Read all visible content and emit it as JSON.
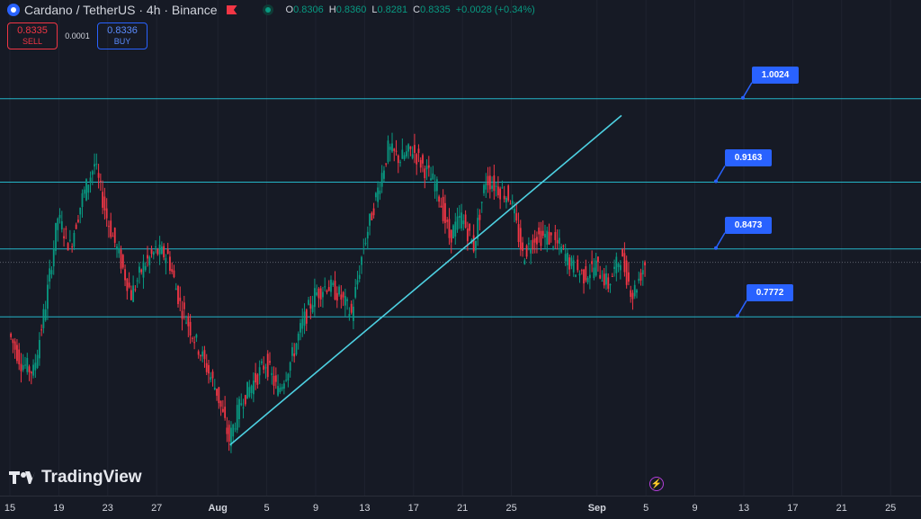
{
  "header": {
    "title": "Cardano / TetherUS · 4h · Binance",
    "ohlc": [
      {
        "k": "O",
        "v": "0.8306"
      },
      {
        "k": "H",
        "v": "0.8360"
      },
      {
        "k": "L",
        "v": "0.8281"
      },
      {
        "k": "C",
        "v": "0.8335"
      },
      {
        "k": "",
        "v": "+0.0028 (+0.34%)"
      }
    ]
  },
  "trade": {
    "sell_price": "0.8335",
    "sell_label": "SELL",
    "spread": "0.0001",
    "buy_price": "0.8336",
    "buy_label": "BUY"
  },
  "branding": {
    "logo_text": "TradingView",
    "flash_icon": "lightning-icon"
  },
  "colors": {
    "up": "#089981",
    "down": "#f23645",
    "level_line": "#26c6da",
    "label_bg": "#2962ff",
    "background": "#161a25"
  },
  "chart_data": {
    "type": "candlestick",
    "symbol": "ADA/USDT",
    "interval": "4h",
    "exchange": "Binance",
    "x_ticks": [
      "15",
      "19",
      "23",
      "27",
      "Aug",
      "5",
      "9",
      "13",
      "17",
      "21",
      "25",
      "Sep",
      "5",
      "9",
      "13",
      "17",
      "21",
      "25"
    ],
    "x_ticks_bold": [
      "Aug",
      "Sep"
    ],
    "ylim": [
      0.5925,
      1.1044
    ],
    "last_price": 0.8335,
    "horizontal_levels": [
      {
        "value": 1.0024,
        "label": "1.0024"
      },
      {
        "value": 0.9163,
        "label": "0.9163"
      },
      {
        "value": 0.8473,
        "label": "0.8473"
      },
      {
        "value": 0.7772,
        "label": "0.7772"
      }
    ],
    "trendline": {
      "from": {
        "date": "Aug 2",
        "value": 0.6449
      },
      "to": {
        "date": "Sep 3",
        "value": 0.9851
      }
    },
    "approx_close_path": [
      {
        "date": "Jul 15",
        "value": 0.76
      },
      {
        "date": "Jul 16",
        "value": 0.73
      },
      {
        "date": "Jul 17",
        "value": 0.72
      },
      {
        "date": "Jul 18",
        "value": 0.79
      },
      {
        "date": "Jul 19",
        "value": 0.88
      },
      {
        "date": "Jul 20",
        "value": 0.85
      },
      {
        "date": "Jul 21",
        "value": 0.9
      },
      {
        "date": "Jul 22",
        "value": 0.935
      },
      {
        "date": "Jul 23",
        "value": 0.88
      },
      {
        "date": "Jul 24",
        "value": 0.84
      },
      {
        "date": "Jul 25",
        "value": 0.8
      },
      {
        "date": "Jul 26",
        "value": 0.83
      },
      {
        "date": "Jul 27",
        "value": 0.845
      },
      {
        "date": "Jul 28",
        "value": 0.84
      },
      {
        "date": "Jul 29",
        "value": 0.79
      },
      {
        "date": "Jul 30",
        "value": 0.76
      },
      {
        "date": "Jul 31",
        "value": 0.73
      },
      {
        "date": "Aug 1",
        "value": 0.7
      },
      {
        "date": "Aug 2",
        "value": 0.65
      },
      {
        "date": "Aug 3",
        "value": 0.69
      },
      {
        "date": "Aug 4",
        "value": 0.71
      },
      {
        "date": "Aug 5",
        "value": 0.73
      },
      {
        "date": "Aug 6",
        "value": 0.7
      },
      {
        "date": "Aug 7",
        "value": 0.73
      },
      {
        "date": "Aug 8",
        "value": 0.77
      },
      {
        "date": "Aug 9",
        "value": 0.8
      },
      {
        "date": "Aug 10",
        "value": 0.81
      },
      {
        "date": "Aug 11",
        "value": 0.8
      },
      {
        "date": "Aug 12",
        "value": 0.78
      },
      {
        "date": "Aug 13",
        "value": 0.85
      },
      {
        "date": "Aug 14",
        "value": 0.9
      },
      {
        "date": "Aug 15",
        "value": 0.95
      },
      {
        "date": "Aug 16",
        "value": 0.94
      },
      {
        "date": "Aug 17",
        "value": 0.95
      },
      {
        "date": "Aug 18",
        "value": 0.93
      },
      {
        "date": "Aug 19",
        "value": 0.91
      },
      {
        "date": "Aug 20",
        "value": 0.86
      },
      {
        "date": "Aug 21",
        "value": 0.88
      },
      {
        "date": "Aug 22",
        "value": 0.85
      },
      {
        "date": "Aug 23",
        "value": 0.92
      },
      {
        "date": "Aug 24",
        "value": 0.91
      },
      {
        "date": "Aug 25",
        "value": 0.9
      },
      {
        "date": "Aug 26",
        "value": 0.84
      },
      {
        "date": "Aug 27",
        "value": 0.86
      },
      {
        "date": "Aug 28",
        "value": 0.86
      },
      {
        "date": "Aug 29",
        "value": 0.85
      },
      {
        "date": "Aug 30",
        "value": 0.83
      },
      {
        "date": "Aug 31",
        "value": 0.82
      },
      {
        "date": "Sep 1",
        "value": 0.83
      },
      {
        "date": "Sep 2",
        "value": 0.81
      },
      {
        "date": "Sep 3",
        "value": 0.84
      },
      {
        "date": "Sep 4",
        "value": 0.8
      },
      {
        "date": "Sep 5",
        "value": 0.833
      }
    ]
  }
}
